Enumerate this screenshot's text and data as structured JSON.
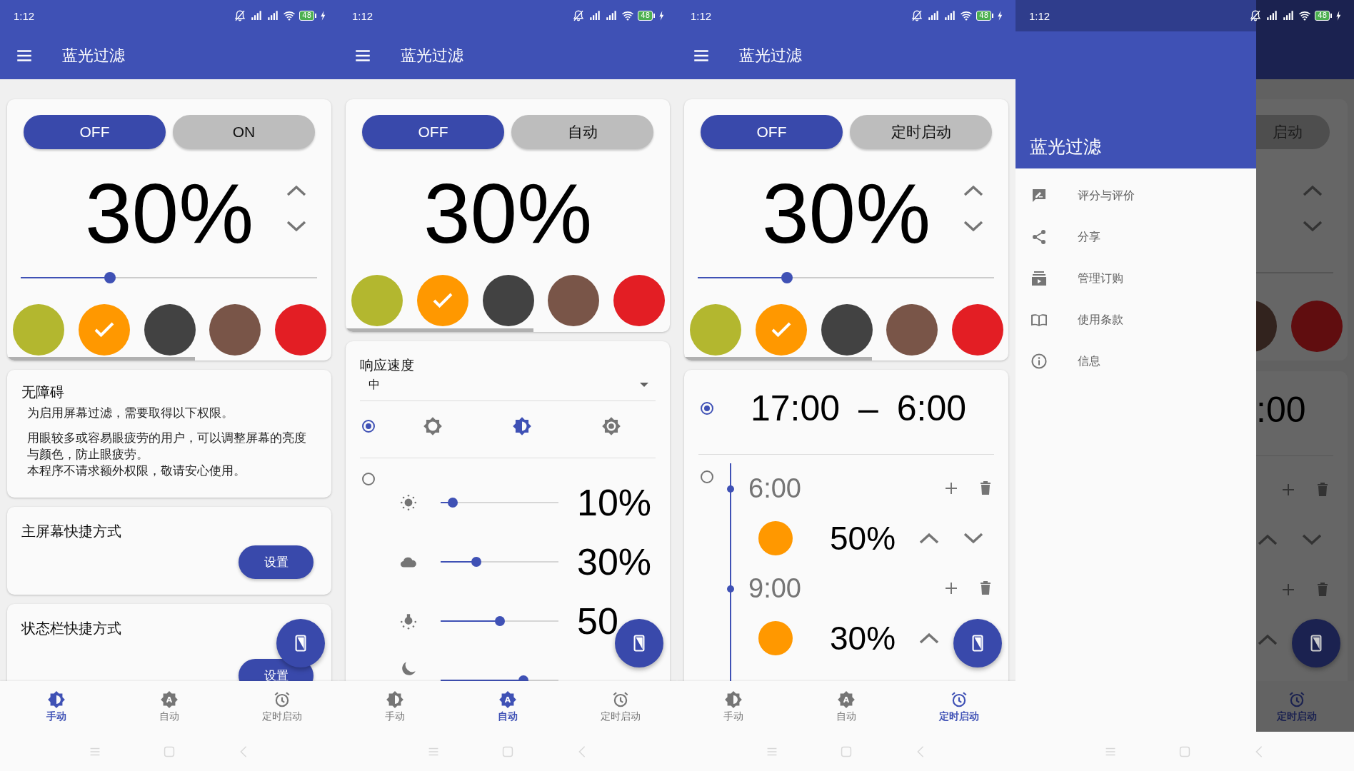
{
  "screens": [
    {
      "kind": "manual",
      "status": {
        "time": "1:12",
        "battery": "48"
      },
      "title": "蓝光过滤",
      "toggle": [
        {
          "label": "OFF",
          "selected": true
        },
        {
          "label": "ON",
          "selected": false
        }
      ],
      "percent": "30%",
      "level": 0.3,
      "swatches": [
        {
          "color": "#b3b72f",
          "selected": false
        },
        {
          "color": "#ff9800",
          "selected": true
        },
        {
          "color": "#424242",
          "selected": false
        },
        {
          "color": "#795548",
          "selected": false
        },
        {
          "color": "#e31e24",
          "selected": false
        }
      ],
      "accessibility": {
        "title": "无障碍",
        "paragraphs": [
          "为启用屏幕过滤，需要取得以下权限。",
          "用眼较多或容易眼疲劳的用户，可以调整屏幕的亮度与颜色，防止眼疲劳。",
          "本程序不请求额外权限，敬请安心使用。"
        ]
      },
      "shortcuts": [
        {
          "title": "主屏幕快捷方式",
          "button": "设置"
        },
        {
          "title": "状态栏快捷方式",
          "button": "设置"
        }
      ],
      "nav": [
        {
          "label": "手动",
          "kind": "manual",
          "selected": true
        },
        {
          "label": "自动",
          "kind": "auto",
          "icon_text": "A",
          "selected": false
        },
        {
          "label": "定时启动",
          "kind": "alarm",
          "selected": false
        }
      ]
    },
    {
      "kind": "auto",
      "status": {
        "time": "1:12",
        "battery": "48"
      },
      "title": "蓝光过滤",
      "toggle": [
        {
          "label": "OFF",
          "selected": true
        },
        {
          "label": "自动",
          "selected": false
        }
      ],
      "percent": "30%",
      "swatches": [
        {
          "color": "#b3b72f",
          "selected": false
        },
        {
          "color": "#ff9800",
          "selected": true
        },
        {
          "color": "#424242",
          "selected": false
        },
        {
          "color": "#795548",
          "selected": false
        },
        {
          "color": "#e31e24",
          "selected": false
        }
      ],
      "response": {
        "label": "响应速度",
        "value": "中"
      },
      "modes": [
        {
          "selected": true,
          "icons": [
            {
              "kind": "outline",
              "selected": false
            },
            {
              "kind": "half",
              "selected": true
            },
            {
              "kind": "dot",
              "selected": false
            }
          ]
        },
        {
          "selected": false,
          "rows": [
            {
              "kind": "sun",
              "level": 0.1,
              "reading": "10%"
            },
            {
              "kind": "cloud",
              "level": 0.3,
              "reading": "30%"
            },
            {
              "kind": "lamp",
              "level": 0.5,
              "reading": "50"
            },
            {
              "kind": "moon",
              "level": 0.7
            }
          ]
        }
      ],
      "nav": [
        {
          "label": "手动",
          "kind": "manual",
          "selected": false
        },
        {
          "label": "自动",
          "kind": "auto",
          "icon_text": "A",
          "selected": true
        },
        {
          "label": "定时启动",
          "kind": "alarm",
          "selected": false
        }
      ]
    },
    {
      "kind": "schedule",
      "status": {
        "time": "1:12",
        "battery": "48"
      },
      "title": "蓝光过滤",
      "toggle": [
        {
          "label": "OFF",
          "selected": true
        },
        {
          "label": "定时启动",
          "selected": false
        }
      ],
      "percent": "30%",
      "level": 0.3,
      "swatches": [
        {
          "color": "#b3b72f",
          "selected": false
        },
        {
          "color": "#ff9800",
          "selected": true
        },
        {
          "color": "#424242",
          "selected": false
        },
        {
          "color": "#795548",
          "selected": false
        },
        {
          "color": "#e31e24",
          "selected": false
        }
      ],
      "schedules": [
        {
          "selected": true,
          "range": "17:00 – 6:00"
        },
        {
          "selected": false,
          "entries": [
            {
              "time": "6:00",
              "color": "#ff9800",
              "percent": "50%"
            },
            {
              "time": "9:00",
              "color": "#ff9800",
              "percent": "30%"
            }
          ]
        }
      ],
      "nav": [
        {
          "label": "手动",
          "kind": "manual",
          "selected": false
        },
        {
          "label": "自动",
          "kind": "auto",
          "icon_text": "A",
          "selected": false
        },
        {
          "label": "定时启动",
          "kind": "alarm",
          "selected": true
        }
      ]
    },
    {
      "kind": "drawer",
      "status": {
        "time": "1:12",
        "battery": "48"
      },
      "drawer": {
        "title": "蓝光过滤",
        "items": [
          {
            "label": "评分与评价",
            "kind": "rate"
          },
          {
            "label": "分享",
            "kind": "share"
          },
          {
            "label": "管理订购",
            "kind": "subscriptions"
          },
          {
            "label": "使用条款",
            "kind": "book"
          },
          {
            "label": "信息",
            "kind": "info"
          }
        ]
      },
      "behind": {
        "button": "启动",
        "time": ":00",
        "nav": {
          "label": "定时启动",
          "selected": true
        }
      }
    }
  ]
}
